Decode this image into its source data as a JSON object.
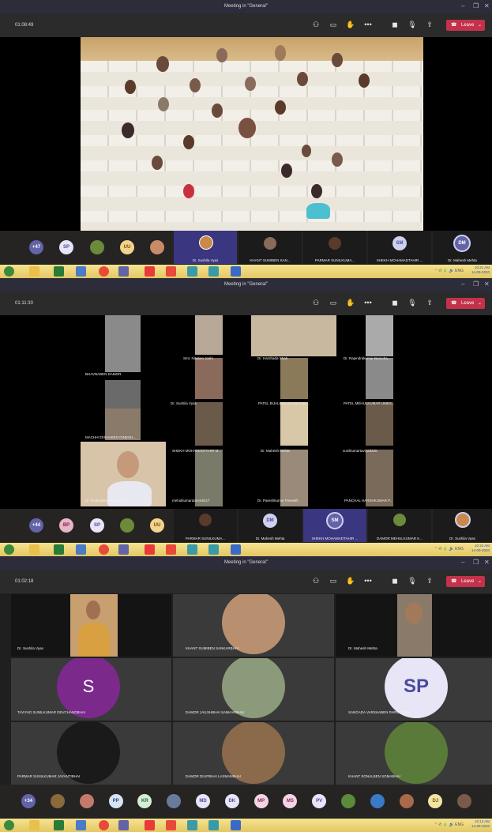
{
  "window_title": "Meeting in \"General\"",
  "leave_label": "Leave",
  "panels": [
    {
      "timer": "01:08:49",
      "participant_overflow": "+47",
      "avatars": [
        {
          "initials": "SP",
          "color": "#e8e6f6",
          "text_color": "#4a4a9e"
        },
        {
          "initials": "",
          "color": "#6b8b3a"
        },
        {
          "initials": "UU",
          "color": "#f4d48a",
          "text_color": "#6a4e10"
        },
        {
          "initials": "",
          "color": "#c98b6a"
        }
      ],
      "video_tiles": [
        {
          "label": "Dr. Sushila Vyas",
          "selected": true
        },
        {
          "label": "KHANT SUMIBEN SAN...",
          "selected": false
        },
        {
          "label": "PARMAR SUNILKUMA...",
          "selected": false
        },
        {
          "label": "SHEKH MOHAMADTAHIR ...",
          "selected": false,
          "initials": "SM"
        },
        {
          "label": "Dr. Mahesh Mehta",
          "selected": false,
          "initials": "DM"
        }
      ],
      "clock_time": "10:21 AM",
      "clock_date": "14-09-2020"
    },
    {
      "timer": "01:11:30",
      "participant_overflow": "+44",
      "avatars": [
        {
          "initials": "BP",
          "color": "#e8b4c8",
          "text_color": "#8a1e4a"
        },
        {
          "initials": "SP",
          "color": "#e8e6f6",
          "text_color": "#4a4a9e"
        },
        {
          "initials": "",
          "color": "#6b8b3a"
        },
        {
          "initials": "UU",
          "color": "#f4d48a",
          "text_color": "#6a4e10"
        }
      ],
      "video_tiles": [
        {
          "label": "PARMAR SUNILKUMA...",
          "selected": false
        },
        {
          "label": "Dr. Mahesh Mehta",
          "selected": false,
          "initials": "DM"
        },
        {
          "label": "SHEKH MOHAMADTAHIR ...",
          "selected": true,
          "initials": "SM"
        },
        {
          "label": "DAMOR MEHULKUMAR K...",
          "selected": false
        },
        {
          "label": "Dr. Sushila Vyas",
          "selected": false
        }
      ],
      "grid_names": [
        "BHAVNABEN DAMOR",
        "Smt. Nitaben Joshi",
        "Dr. Harshada Shah",
        "Dr. Rajendrakumar Bamoha...",
        "Dr. Sushila Vyas",
        "PATEL BIJALBEN BHARATBH...",
        "PATEL MEHULKUMAR UMES...",
        "MACHHI DISHABEN DINESH...",
        "SHEKH MOHAMADTAHIR M...",
        "Dr. Mahesh Mehta",
        "sunilkumartaviyad325",
        "Dr. Prakashkumar Vekaria",
        "mehulkumardamor6217",
        "Dr. Pareshkumar Pareekh",
        "PANCHAL HARSHKUMAR P..."
      ],
      "clock_time": "10:24 AM",
      "clock_date": "14-09-2020"
    },
    {
      "timer": "01:02:18",
      "participant_overflow": "+34",
      "grid": [
        {
          "name": "Dr. Sushila Vyas",
          "kind": "photo"
        },
        {
          "name": "KHANT SUMIBEN SANKARBHAI",
          "kind": "photo-circle"
        },
        {
          "name": "Dr. Mahesh Mehta",
          "kind": "photo"
        },
        {
          "name": "TAVIYAD SUNILKUMAR DEVCHANDBHAI",
          "kind": "initial",
          "initials": "S",
          "color": "#7b2a8c"
        },
        {
          "name": "DAMOR JAILSHBHAI SANKARBHAI",
          "kind": "photo-circle"
        },
        {
          "name": "SANGADA VARSHABEN PARVATSINH",
          "kind": "initial",
          "initials": "SP",
          "color": "#e8e6f6"
        },
        {
          "name": "PARMAR SUNILKUMAR JAYANTIBHAI",
          "kind": "photo-circle"
        },
        {
          "name": "DAMOR DILIPBHAI LAXMANBHAI",
          "kind": "photo-circle"
        },
        {
          "name": "KHANT SONALBEN SOMABHAI",
          "kind": "photo-circle"
        }
      ],
      "avatars": [
        {
          "initials": "",
          "color": "#8b6a3a"
        },
        {
          "initials": "",
          "color": "#c47a6a"
        },
        {
          "initials": "PP",
          "color": "#d6e4f4",
          "text_color": "#2a4a7a"
        },
        {
          "initials": "KR",
          "color": "#d7ecd5",
          "text_color": "#2a6a2a"
        },
        {
          "initials": "",
          "color": "#6a7a9a"
        },
        {
          "initials": "MD",
          "color": "#e8e6f6",
          "text_color": "#4a4a9e"
        },
        {
          "initials": "DK",
          "color": "#e8e6f6",
          "text_color": "#4a4a9e"
        },
        {
          "initials": "MP",
          "color": "#f4d4e4",
          "text_color": "#8a2a5a"
        },
        {
          "initials": "MS",
          "color": "#f4d4e4",
          "text_color": "#8a2a5a"
        },
        {
          "initials": "PV",
          "color": "#e8e6f6",
          "text_color": "#4a4a9e"
        },
        {
          "initials": "",
          "color": "#5a8a3a"
        },
        {
          "initials": "",
          "color": "#3a7ac8"
        },
        {
          "initials": "",
          "color": "#a86a4a"
        },
        {
          "initials": "DJ",
          "color": "#f4e4a4",
          "text_color": "#6a5a10"
        },
        {
          "initials": "",
          "color": "#7a5a4a"
        }
      ],
      "clock_time": "10:13 AM",
      "clock_date": "14-09-2020"
    }
  ],
  "icons": {
    "people": "people-icon",
    "chat": "chat-icon",
    "raise_hand": "raise-hand-icon",
    "more": "more-options-icon",
    "camera": "camera-icon",
    "mic": "microphone-icon",
    "share": "share-screen-icon",
    "phone": "phone-icon"
  },
  "accent_color": "#6264a7",
  "leave_color": "#c4314b"
}
